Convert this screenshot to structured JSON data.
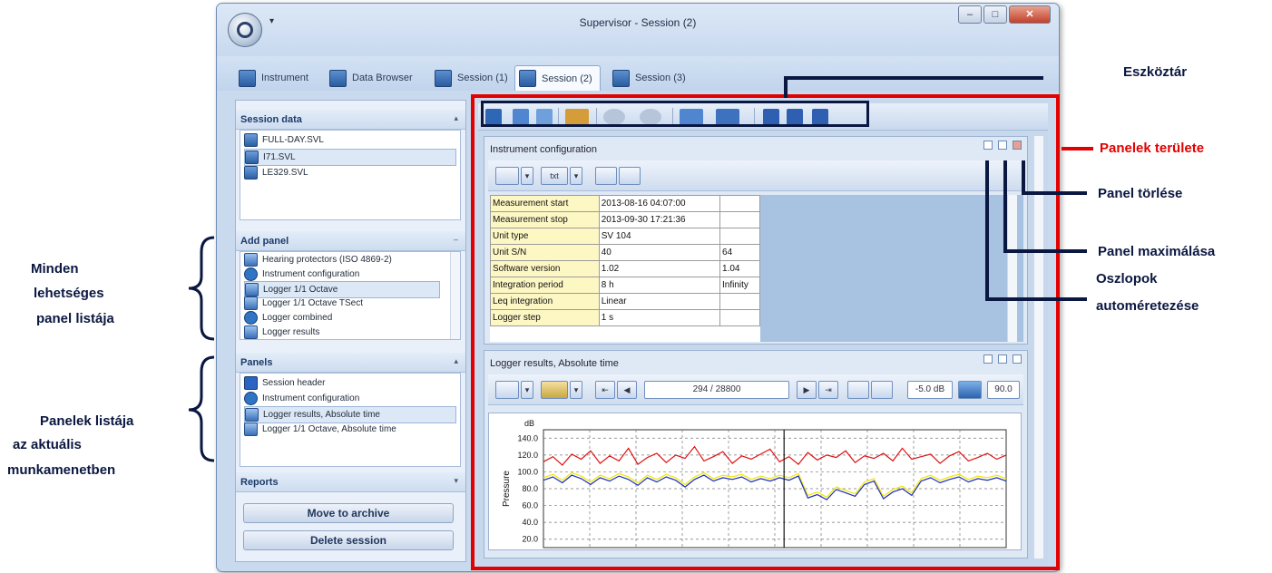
{
  "window": {
    "title": "Supervisor - Session (2)",
    "quick_access": "▾",
    "controls": {
      "minimize": "–",
      "maximize": "□",
      "close": "✕"
    }
  },
  "tabs": [
    {
      "label": "Instrument"
    },
    {
      "label": "Data Browser"
    },
    {
      "label": "Session (1)"
    },
    {
      "label": "Session (2)"
    },
    {
      "label": "Session (3)"
    }
  ],
  "left": {
    "session_data": {
      "title": "Session data",
      "collapse": "▴",
      "files": [
        "FULL-DAY.SVL",
        "I71.SVL",
        "LE329.SVL"
      ]
    },
    "add_panel": {
      "title": "Add panel",
      "collapse": "–",
      "items": [
        "Hearing protectors (ISO 4869-2)",
        "Instrument configuration",
        "Logger 1/1 Octave",
        "Logger 1/1 Octave TSect",
        "Logger combined",
        "Logger results"
      ]
    },
    "panels": {
      "title": "Panels",
      "collapse": "▴",
      "items": [
        "Session header",
        "Instrument configuration",
        "Logger results, Absolute time",
        "Logger 1/1 Octave, Absolute time"
      ]
    },
    "reports": {
      "title": "Reports",
      "collapse": "▾"
    },
    "buttons": {
      "archive": "Move to archive",
      "delete": "Delete session"
    }
  },
  "config_panel": {
    "title": "Instrument configuration",
    "tool_txt": "txt",
    "rows": [
      [
        "Measurement start",
        "2013-08-16 04:07:00",
        ""
      ],
      [
        "Measurement stop",
        "2013-09-30 17:21:36",
        ""
      ],
      [
        "Unit type",
        "SV 104",
        ""
      ],
      [
        "Unit S/N",
        "40",
        "64"
      ],
      [
        "Software version",
        "1.02",
        "1.04"
      ],
      [
        "Integration period",
        "8 h",
        "Infinity"
      ],
      [
        "Leq integration",
        "Linear",
        ""
      ],
      [
        "Logger step",
        "1 s",
        ""
      ]
    ]
  },
  "logger_panel": {
    "title": "Logger results, Absolute time",
    "position": "294 / 28800",
    "offset": "-5.0 dB",
    "level": "90.0"
  },
  "chart_data": {
    "type": "line",
    "ylabel": "Pressure",
    "yunit": "dB",
    "yticks": [
      20.0,
      40.0,
      60.0,
      80.0,
      100.0,
      120.0,
      140.0
    ],
    "ylim": [
      10,
      150
    ],
    "grid": true,
    "series": [
      {
        "color": "#e01010",
        "values": [
          112,
          118,
          108,
          121,
          115,
          125,
          110,
          119,
          113,
          128,
          109,
          117,
          122,
          111,
          120,
          116,
          130,
          113,
          118,
          124,
          110,
          119,
          115,
          121,
          127,
          112,
          118,
          109,
          123,
          114,
          120,
          117,
          125,
          111,
          119,
          116,
          122,
          113,
          128,
          115,
          118,
          121,
          110,
          119,
          124,
          113,
          117,
          122,
          115,
          120
        ]
      },
      {
        "color": "#f2e600",
        "values": [
          93,
          97,
          90,
          99,
          95,
          88,
          96,
          92,
          98,
          94,
          87,
          96,
          91,
          97,
          93,
          85,
          94,
          99,
          92,
          96,
          94,
          97,
          91,
          95,
          92,
          96,
          93,
          98,
          72,
          76,
          70,
          82,
          78,
          74,
          88,
          92,
          71,
          79,
          83,
          75,
          92,
          96,
          90,
          94,
          97,
          91,
          95,
          93,
          96,
          92
        ]
      },
      {
        "color": "#1a2eb8",
        "values": [
          90,
          94,
          87,
          96,
          92,
          85,
          93,
          89,
          95,
          91,
          84,
          93,
          88,
          94,
          90,
          82,
          91,
          96,
          89,
          93,
          91,
          94,
          88,
          92,
          89,
          93,
          90,
          95,
          69,
          73,
          67,
          79,
          75,
          71,
          85,
          89,
          68,
          76,
          80,
          72,
          89,
          93,
          87,
          91,
          94,
          88,
          92,
          90,
          93,
          89
        ]
      }
    ]
  },
  "annotations": {
    "toolbar": "Eszköztár",
    "panels_area": "Panelek területe",
    "panel_delete": "Panel törlése",
    "panel_maximize": "Panel maximálása",
    "autosize_1": "Oszlopok",
    "autosize_2": "automéretezése",
    "all_panels_1": "Minden",
    "all_panels_2": "lehetséges",
    "all_panels_3": "panel listája",
    "session_panels_1": "Panelek listája",
    "session_panels_2": "az aktuális",
    "session_panels_3": "munkamenetben",
    "colors": {
      "red": "#e30000",
      "navy": "#0a1740"
    }
  }
}
